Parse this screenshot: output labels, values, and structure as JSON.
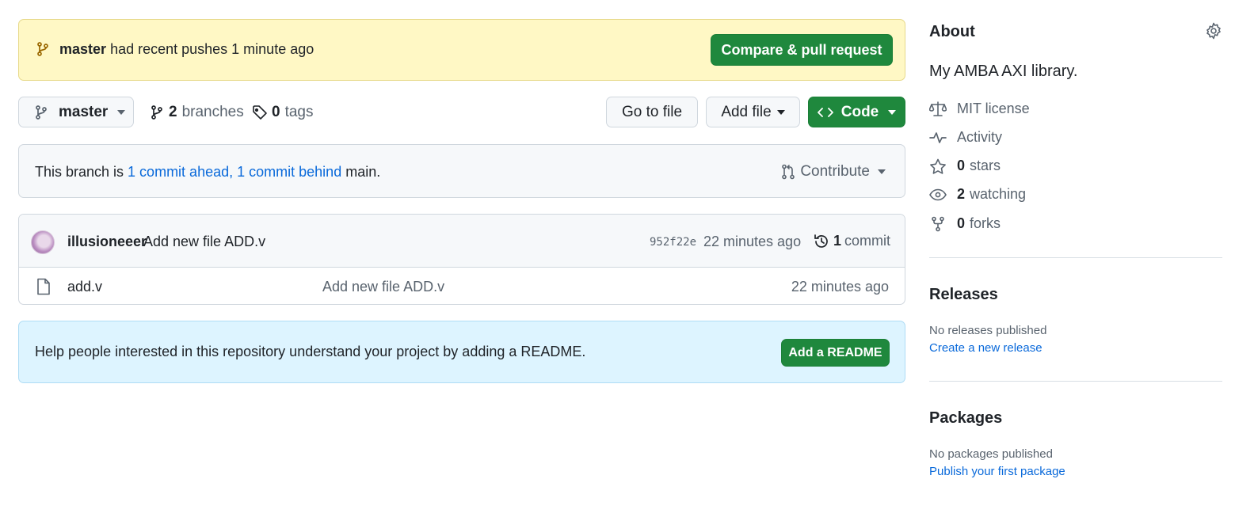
{
  "push_banner": {
    "branch": "master",
    "message": "had recent pushes 1 minute ago",
    "button": "Compare & pull request"
  },
  "toolbar": {
    "branch_name": "master",
    "branches_count": "2",
    "branches_label": "branches",
    "tags_count": "0",
    "tags_label": "tags",
    "goto_file": "Go to file",
    "add_file": "Add file",
    "code": "Code"
  },
  "branch_status": {
    "prefix": "This branch is ",
    "ahead": "1 commit ahead",
    "separator": ", ",
    "behind": "1 commit behind",
    "suffix": " main.",
    "contribute": "Contribute"
  },
  "latest_commit": {
    "author": "illusioneeer",
    "message": "Add new file ADD.v",
    "sha": "952f22e",
    "time": "22 minutes ago",
    "count": "1",
    "count_label": "commit"
  },
  "files": [
    {
      "name": "add.v",
      "commit_message": "Add new file ADD.v",
      "time": "22 minutes ago"
    }
  ],
  "readme_prompt": {
    "text": "Help people interested in this repository understand your project by adding a README.",
    "button": "Add a README"
  },
  "about": {
    "title": "About",
    "description": "My AMBA AXI library.",
    "license": "MIT license",
    "activity": "Activity",
    "stars_count": "0",
    "stars_label": "stars",
    "watching_count": "2",
    "watching_label": "watching",
    "forks_count": "0",
    "forks_label": "forks"
  },
  "releases": {
    "title": "Releases",
    "empty_text": "No releases published",
    "link": "Create a new release"
  },
  "packages": {
    "title": "Packages",
    "empty_text": "No packages published",
    "link": "Publish your first package"
  },
  "colors": {
    "accent_green": "#1f883d",
    "link_blue": "#0969da",
    "banner_yellow": "#fff8c5",
    "info_blue": "#ddf4ff"
  }
}
